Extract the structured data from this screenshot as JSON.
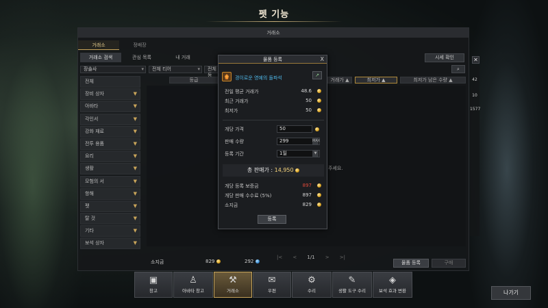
{
  "page_title": "펫 기능",
  "panel": {
    "header": "거래소",
    "top_tabs": [
      "거래소",
      "정배장"
    ],
    "sub_tabs": [
      "거래소 검색",
      "관심 목록",
      "내 거래"
    ],
    "market_button": "시세 확인"
  },
  "categories": {
    "select_value": "장솔사",
    "items": [
      "전체",
      "장비 상자",
      "아바타",
      "각인서",
      "강화 재료",
      "전투 용품",
      "요리",
      "생활",
      "모험의 서",
      "항해",
      "펫",
      "탈 것",
      "기타",
      "보석 상자"
    ]
  },
  "filters": {
    "tier": "전체 티어",
    "grade": "전체 등"
  },
  "columns": {
    "grade": "등급",
    "unit_price": "거래가",
    "lowest_price": "최저가",
    "remaining": "최저가 남은 수량"
  },
  "results_hint": "주세요.",
  "pagination": {
    "first": "|<",
    "prev": "<",
    "page": "1/1",
    "next": ">",
    "last": ">|"
  },
  "wallet": {
    "label": "소지금",
    "gold": "829",
    "crystal": "292"
  },
  "buttons": {
    "item_register": "물품 등록",
    "buy": "구매",
    "exit": "나가기"
  },
  "modal": {
    "title": "물품 등록",
    "close": "X",
    "item_name": "경이로운 영예의 돌파석",
    "trend_icon": "chart-up",
    "rows": [
      {
        "label": "전일 평균 거래가",
        "value": "48.6"
      },
      {
        "label": "최근 거래가",
        "value": "50"
      },
      {
        "label": "최저가",
        "value": "50"
      }
    ],
    "unit_price_label": "개당 가격",
    "unit_price_value": "50",
    "quantity_label": "판매 수량",
    "quantity_value": "299",
    "stepper_label": "MAX",
    "period_label": "등록 기간",
    "period_value": "1일",
    "total_label": "총 판매가 :",
    "total_value": "14,950",
    "fees": [
      {
        "label": "개당 등록 보증금",
        "value": "897",
        "color": "#e04a3a"
      },
      {
        "label": "개당 판매 수수료 (5%)",
        "value": "897",
        "color": "#d9d9d9"
      },
      {
        "label": "소지금",
        "value": "829",
        "color": "#d9d9d9"
      }
    ],
    "register_button": "등록"
  },
  "dock": [
    {
      "label": "창고",
      "icon": "chest-icon",
      "glyph": "▣"
    },
    {
      "label": "아바타 창고",
      "icon": "avatar-chest-icon",
      "glyph": "♙"
    },
    {
      "label": "거래소",
      "icon": "gavel-icon",
      "glyph": "⚒",
      "active": true
    },
    {
      "label": "우편",
      "icon": "mail-icon",
      "glyph": "✉"
    },
    {
      "label": "수리",
      "icon": "anvil-icon",
      "glyph": "⚙"
    },
    {
      "label": "생활 도구 수리",
      "icon": "tool-repair-icon",
      "glyph": "✎"
    },
    {
      "label": "보석 효과 변환",
      "icon": "gem-icon",
      "glyph": "◈"
    }
  ],
  "side_numbers": [
    "42",
    "10",
    "1577"
  ],
  "colors": {
    "accent_gold": "#c9a55a",
    "item_blue": "#4fb7e8",
    "warning_red": "#e04a3a"
  }
}
